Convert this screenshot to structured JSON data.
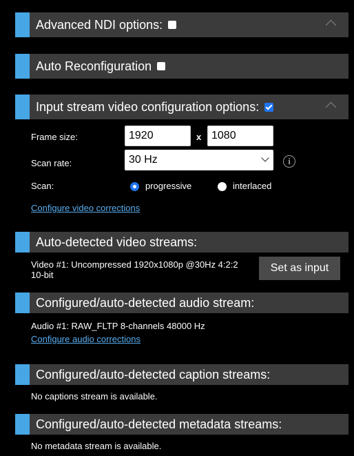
{
  "advanced_ndi": {
    "title": "Advanced NDI options:"
  },
  "auto_reconfig": {
    "title": "Auto Reconfiguration"
  },
  "input_config": {
    "title": "Input stream video configuration options:",
    "frame_size_label": "Frame size:",
    "width": "1920",
    "x_separator": "x",
    "height": "1080",
    "scan_rate_label": "Scan rate:",
    "scan_rate_value": "30 Hz",
    "info_icon": "i",
    "scan_label": "Scan:",
    "progressive_label": "progressive",
    "interlaced_label": "interlaced",
    "video_corrections_link": "Configure video corrections"
  },
  "auto_video": {
    "title": "Auto-detected video streams:",
    "stream_line1": "Video #1: Uncompressed 1920x1080p @30Hz 4:2:2",
    "stream_line2": "10-bit",
    "set_input_label": "Set as input"
  },
  "audio": {
    "title": "Configured/auto-detected audio stream:",
    "stream": "Audio #1: RAW_FLTP 8-channels 48000 Hz",
    "audio_corrections_link": "Configure audio corrections"
  },
  "captions": {
    "title": "Configured/auto-detected caption streams:",
    "message": "No captions stream is available."
  },
  "metadata": {
    "title": "Configured/auto-detected metadata streams:",
    "message": "No metadata stream is available."
  },
  "colors": {
    "accent": "#47a6e6",
    "header_bg": "#3b3b3b",
    "link": "#5aaef0",
    "checkbox_checked": "#1f74f0"
  }
}
